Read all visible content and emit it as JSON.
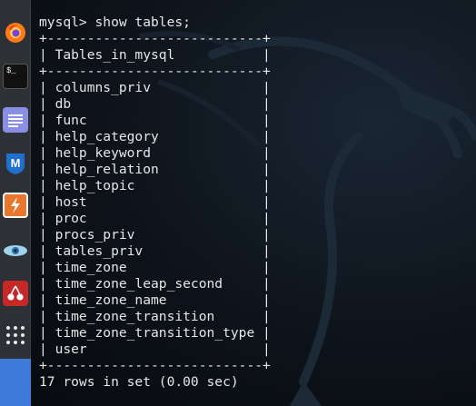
{
  "dock": {
    "items": [
      {
        "name": "firefox",
        "icon": "firefox-icon"
      },
      {
        "name": "terminal",
        "icon": "terminal-icon",
        "glyph": "$_"
      },
      {
        "name": "text-editor",
        "icon": "notepad-icon"
      },
      {
        "name": "metasploit",
        "icon": "metasploit-icon",
        "glyph": "M"
      },
      {
        "name": "burpsuite",
        "icon": "burpsuite-icon"
      },
      {
        "name": "maltego",
        "icon": "eye-icon"
      },
      {
        "name": "cherrytree",
        "icon": "cherry-icon"
      }
    ],
    "show_apps": "show-applications-icon"
  },
  "terminal": {
    "prompt_line": "mysql> show tables;",
    "border": "+---------------------------+",
    "header": "| Tables_in_mysql           |",
    "rows": [
      "| columns_priv              |",
      "| db                        |",
      "| func                      |",
      "| help_category             |",
      "| help_keyword              |",
      "| help_relation             |",
      "| help_topic                |",
      "| host                      |",
      "| proc                      |",
      "| procs_priv                |",
      "| tables_priv               |",
      "| time_zone                 |",
      "| time_zone_leap_second     |",
      "| time_zone_name            |",
      "| time_zone_transition      |",
      "| time_zone_transition_type |",
      "| user                      |"
    ],
    "status": "17 rows in set (0.00 sec)"
  },
  "colors": {
    "terminal_text": "#e6e6e6",
    "dock_bg": "#2d3035",
    "accent_blue": "#3d7bd8"
  }
}
